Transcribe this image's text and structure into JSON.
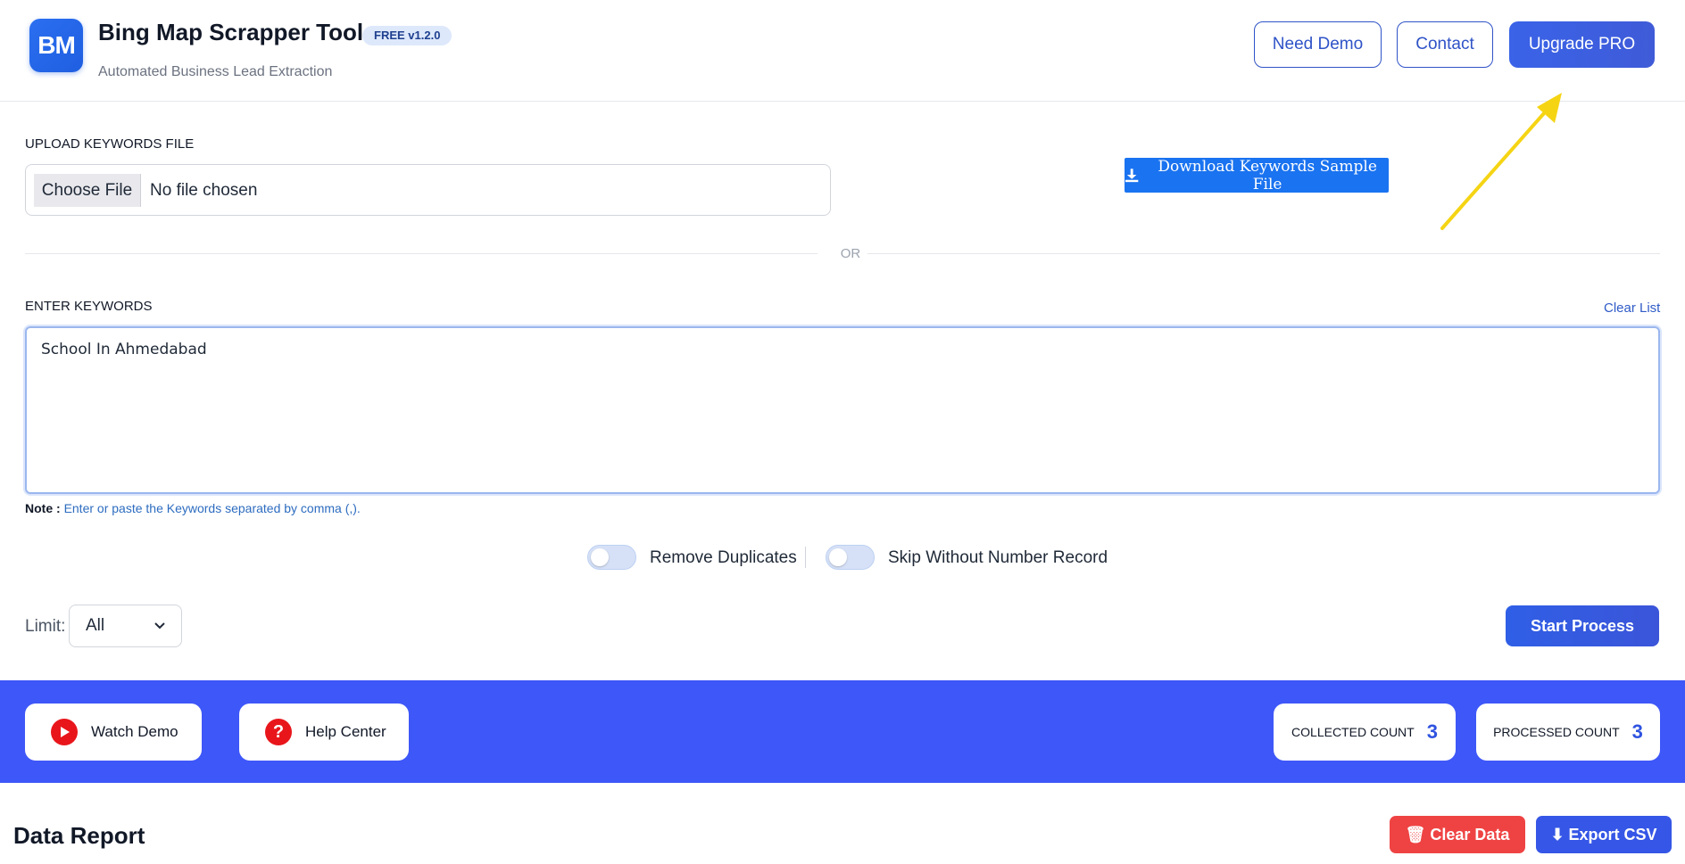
{
  "header": {
    "logo_text": "BM",
    "title": "Bing Map Scrapper Tool",
    "version_badge": "FREE v1.2.0",
    "subtitle": "Automated Business Lead Extraction",
    "buttons": {
      "need_demo": "Need Demo",
      "contact": "Contact",
      "upgrade": "Upgrade PRO"
    }
  },
  "upload": {
    "label": "UPLOAD KEYWORDS FILE",
    "choose_file": "Choose File",
    "file_status": "No file chosen",
    "download_sample": "Download Keywords Sample File",
    "download_icon": "download-icon"
  },
  "divider": {
    "text": "OR"
  },
  "keywords": {
    "label": "ENTER KEYWORDS",
    "clear_list": "Clear List",
    "value": "School In Ahmedabad",
    "note_prefix": "Note :",
    "note_text": "Enter or paste the Keywords separated by comma (,)."
  },
  "options": {
    "remove_duplicates": {
      "label": "Remove Duplicates",
      "enabled": false
    },
    "skip_without_number": {
      "label": "Skip Without Number Record",
      "enabled": false
    }
  },
  "limit": {
    "label": "Limit:",
    "selected": "All"
  },
  "start_button": "Start Process",
  "band": {
    "color": "#3e57f8",
    "watch_demo": "Watch Demo",
    "help_center": "Help Center",
    "collected_label": "COLLECTED COUNT",
    "collected_value": "3",
    "processed_label": "PROCESSED COUNT",
    "processed_value": "3"
  },
  "report": {
    "title": "Data Report",
    "clear_data": "🗑 Clear Data",
    "export_csv": "⬇ Export CSV"
  },
  "colors": {
    "primary": "#3a5be6",
    "download_button": "#1a73f0",
    "danger": "#ef4343",
    "annotation_arrow": "#f5d414"
  }
}
